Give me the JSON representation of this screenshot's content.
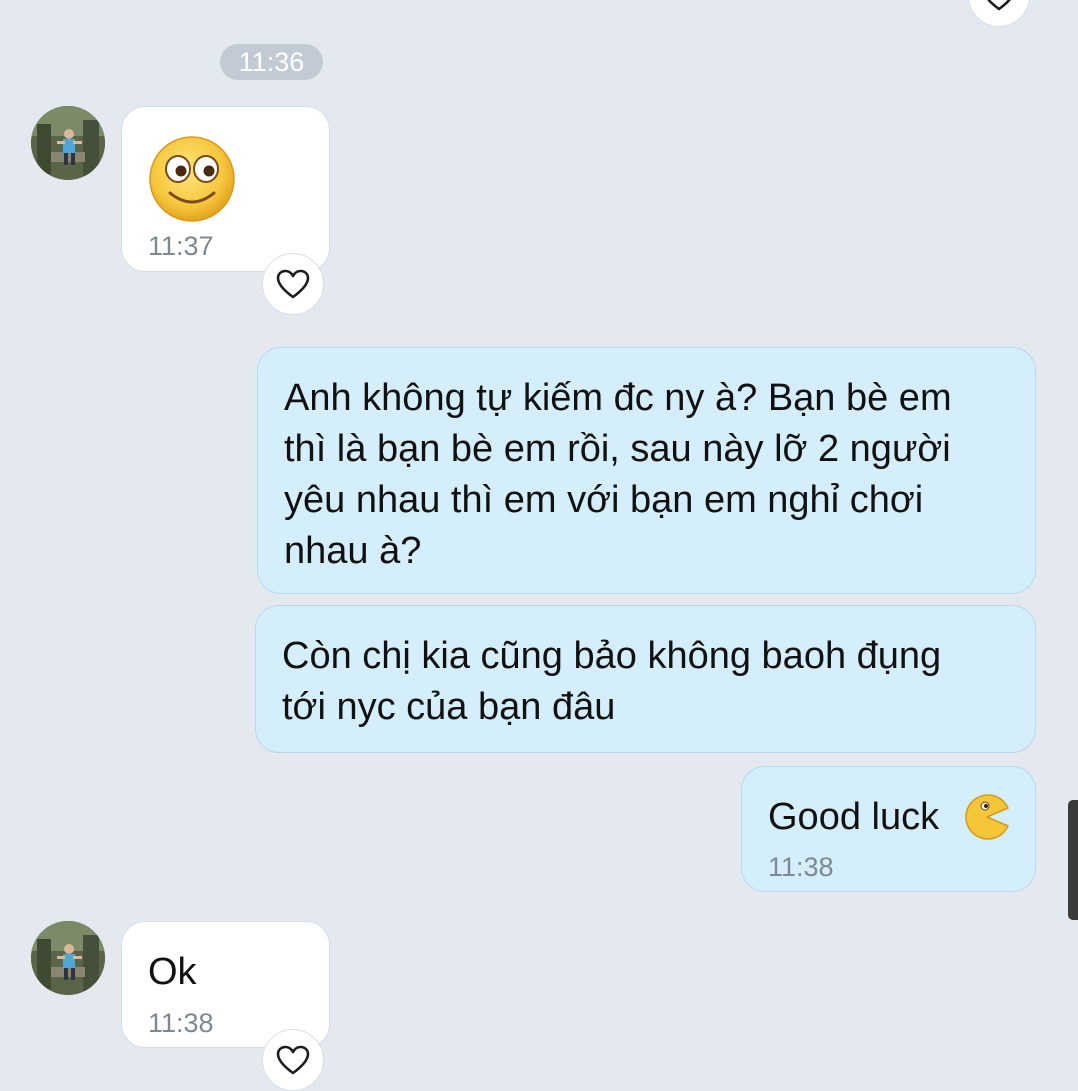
{
  "chat": {
    "time_separator": "11:36",
    "messages": [
      {
        "sender": "other",
        "content": "smiley-emoji",
        "time": "11:37"
      },
      {
        "sender": "me",
        "text": "Anh không tự kiếm đc ny à? Bạn bè em\nthì là bạn bè em rồi, sau này lỡ 2 người\nyêu nhau thì em với bạn em nghỉ chơi\nnhau à?"
      },
      {
        "sender": "me",
        "text": "Còn chị kia cũng bảo không baoh đụng\ntới nyc của bạn đâu"
      },
      {
        "sender": "me",
        "text": "Good luck",
        "emoji": "pacman-emoji",
        "time": "11:38"
      },
      {
        "sender": "other",
        "text": "Ok",
        "time": "11:38"
      }
    ]
  },
  "icons": {
    "reaction": "heart-icon",
    "avatar": "contact-avatar"
  },
  "colors": {
    "background": "#e3e9ef",
    "incoming_bubble": "#ffffff",
    "outgoing_bubble": "#d5eefc",
    "time_pill": "#c2cbd3"
  }
}
